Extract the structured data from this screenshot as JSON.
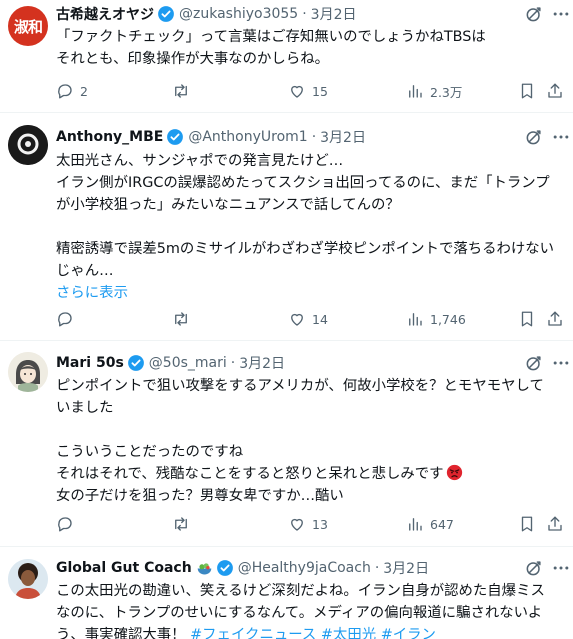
{
  "tweets": [
    {
      "name": "古希越えオヤジ",
      "handle": "@zukashiyo3055",
      "dot": "·",
      "date": "3月2日",
      "avatar_text": "淑和",
      "lines": [
        "「ファクトチェック」って言葉はご存知無いのでしょうかねTBSは",
        "それとも、印象操作が大事なのかしらね。"
      ],
      "reply_count": "2",
      "retweet_count": "",
      "like_count": "15",
      "view_count": "2.3万"
    },
    {
      "name": "Anthony_MBE",
      "handle": "@AnthonyUrom1",
      "dot": "·",
      "date": "3月2日",
      "lines": [
        "太田光さん、サンジャポでの発言見たけど…",
        "イラン側がIRGCの誤爆認めたってスクショ出回ってるのに、まだ「トランプ",
        "が小学校狙った」みたいなニュアンスで話してんの？",
        "",
        "精密誘導で誤差5mのミサイルがわざわざ学校ピンポイントで落ちるわけない",
        "じゃん…"
      ],
      "show_more": "さらに表示",
      "reply_count": "",
      "retweet_count": "",
      "like_count": "14",
      "view_count": "1,746"
    },
    {
      "name": "Mari 50s",
      "handle": "@50s_mari",
      "dot": "·",
      "date": "3月2日",
      "lines": [
        "ピンポイントで狙い攻撃をするアメリカが、何故小学校を？とモヤモヤして",
        "いました",
        "",
        "こういうことだったのですね",
        "それはそれで、残酷なことをすると怒りと呆れと悲しみです",
        "女の子だけを狙った？男尊女卑ですか…酷い"
      ],
      "reply_count": "",
      "retweet_count": "",
      "like_count": "13",
      "view_count": "647"
    },
    {
      "name": "Global Gut Coach",
      "handle": "@Healthy9jaCoach",
      "dot": "·",
      "date": "3月2日",
      "lines": [
        "この太田光の勘違い、笑えるけど深刻だよね。イラン自身が認めた自爆ミス",
        "なのに、トランプのせいにするなんて。メディアの偏向報道に騙されないよ",
        "う、事実確認大事！"
      ],
      "hashtags": [
        "#フェイクニュース",
        "#太田光",
        "#イラン"
      ]
    }
  ],
  "icons": {
    "verified": "verified-badge-icon",
    "grok": "grok-icon",
    "more": "more-options-icon",
    "reply": "reply-icon",
    "retweet": "retweet-icon",
    "like": "like-icon",
    "views": "views-icon",
    "bookmark": "bookmark-icon",
    "share": "share-icon",
    "angry": "angry-face-emoji",
    "salad": "salad-emoji"
  },
  "colors": {
    "accent": "#1d9bf0",
    "muted": "#536471",
    "text": "#0f1419",
    "divider": "#eff3f4"
  }
}
